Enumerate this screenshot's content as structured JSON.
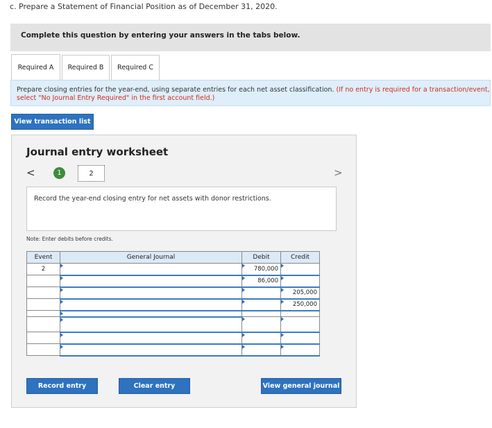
{
  "question": "c. Prepare a Statement of Financial Position as of December 31, 2020.",
  "banner": "Complete this question by entering your answers in the tabs below.",
  "tabs": [
    "Required A",
    "Required B",
    "Required C"
  ],
  "instructions": {
    "main": "Prepare closing entries for the year-end, using separate entries for each net asset classification.",
    "note": "(If no entry is required for a transaction/event, select \"No Journal Entry Required\" in the first account field.)"
  },
  "view_transactions_label": "View transaction list",
  "worksheet": {
    "title": "Journal entry worksheet",
    "prev_icon": "<",
    "next_icon": ">",
    "steps": [
      "1",
      "2"
    ],
    "current_step": "2",
    "description": "Record the year-end closing entry for net assets with donor restrictions.",
    "note": "Note: Enter debits before credits."
  },
  "journal": {
    "headers": {
      "event": "Event",
      "account": "General Journal",
      "debit": "Debit",
      "credit": "Credit"
    },
    "rows": [
      {
        "event": "2",
        "account": "",
        "debit": "780,000",
        "credit": ""
      },
      {
        "event": "",
        "account": "",
        "debit": "86,000",
        "credit": ""
      },
      {
        "event": "",
        "account": "",
        "debit": "",
        "credit": "205,000"
      },
      {
        "event": "",
        "account": "",
        "debit": "",
        "credit": "250,000"
      },
      {
        "event": "",
        "account": "",
        "debit": "",
        "credit": ""
      },
      {
        "event": "",
        "account": "",
        "debit": "",
        "credit": ""
      },
      {
        "event": "",
        "account": "",
        "debit": "",
        "credit": ""
      },
      {
        "event": "",
        "account": "",
        "debit": "",
        "credit": ""
      }
    ]
  },
  "buttons": {
    "record": "Record entry",
    "clear": "Clear entry",
    "view_journal": "View general journal"
  },
  "colors": {
    "accent": "#2e72c0",
    "step_complete": "#3d8c3d",
    "note_red": "#d52a1c"
  }
}
